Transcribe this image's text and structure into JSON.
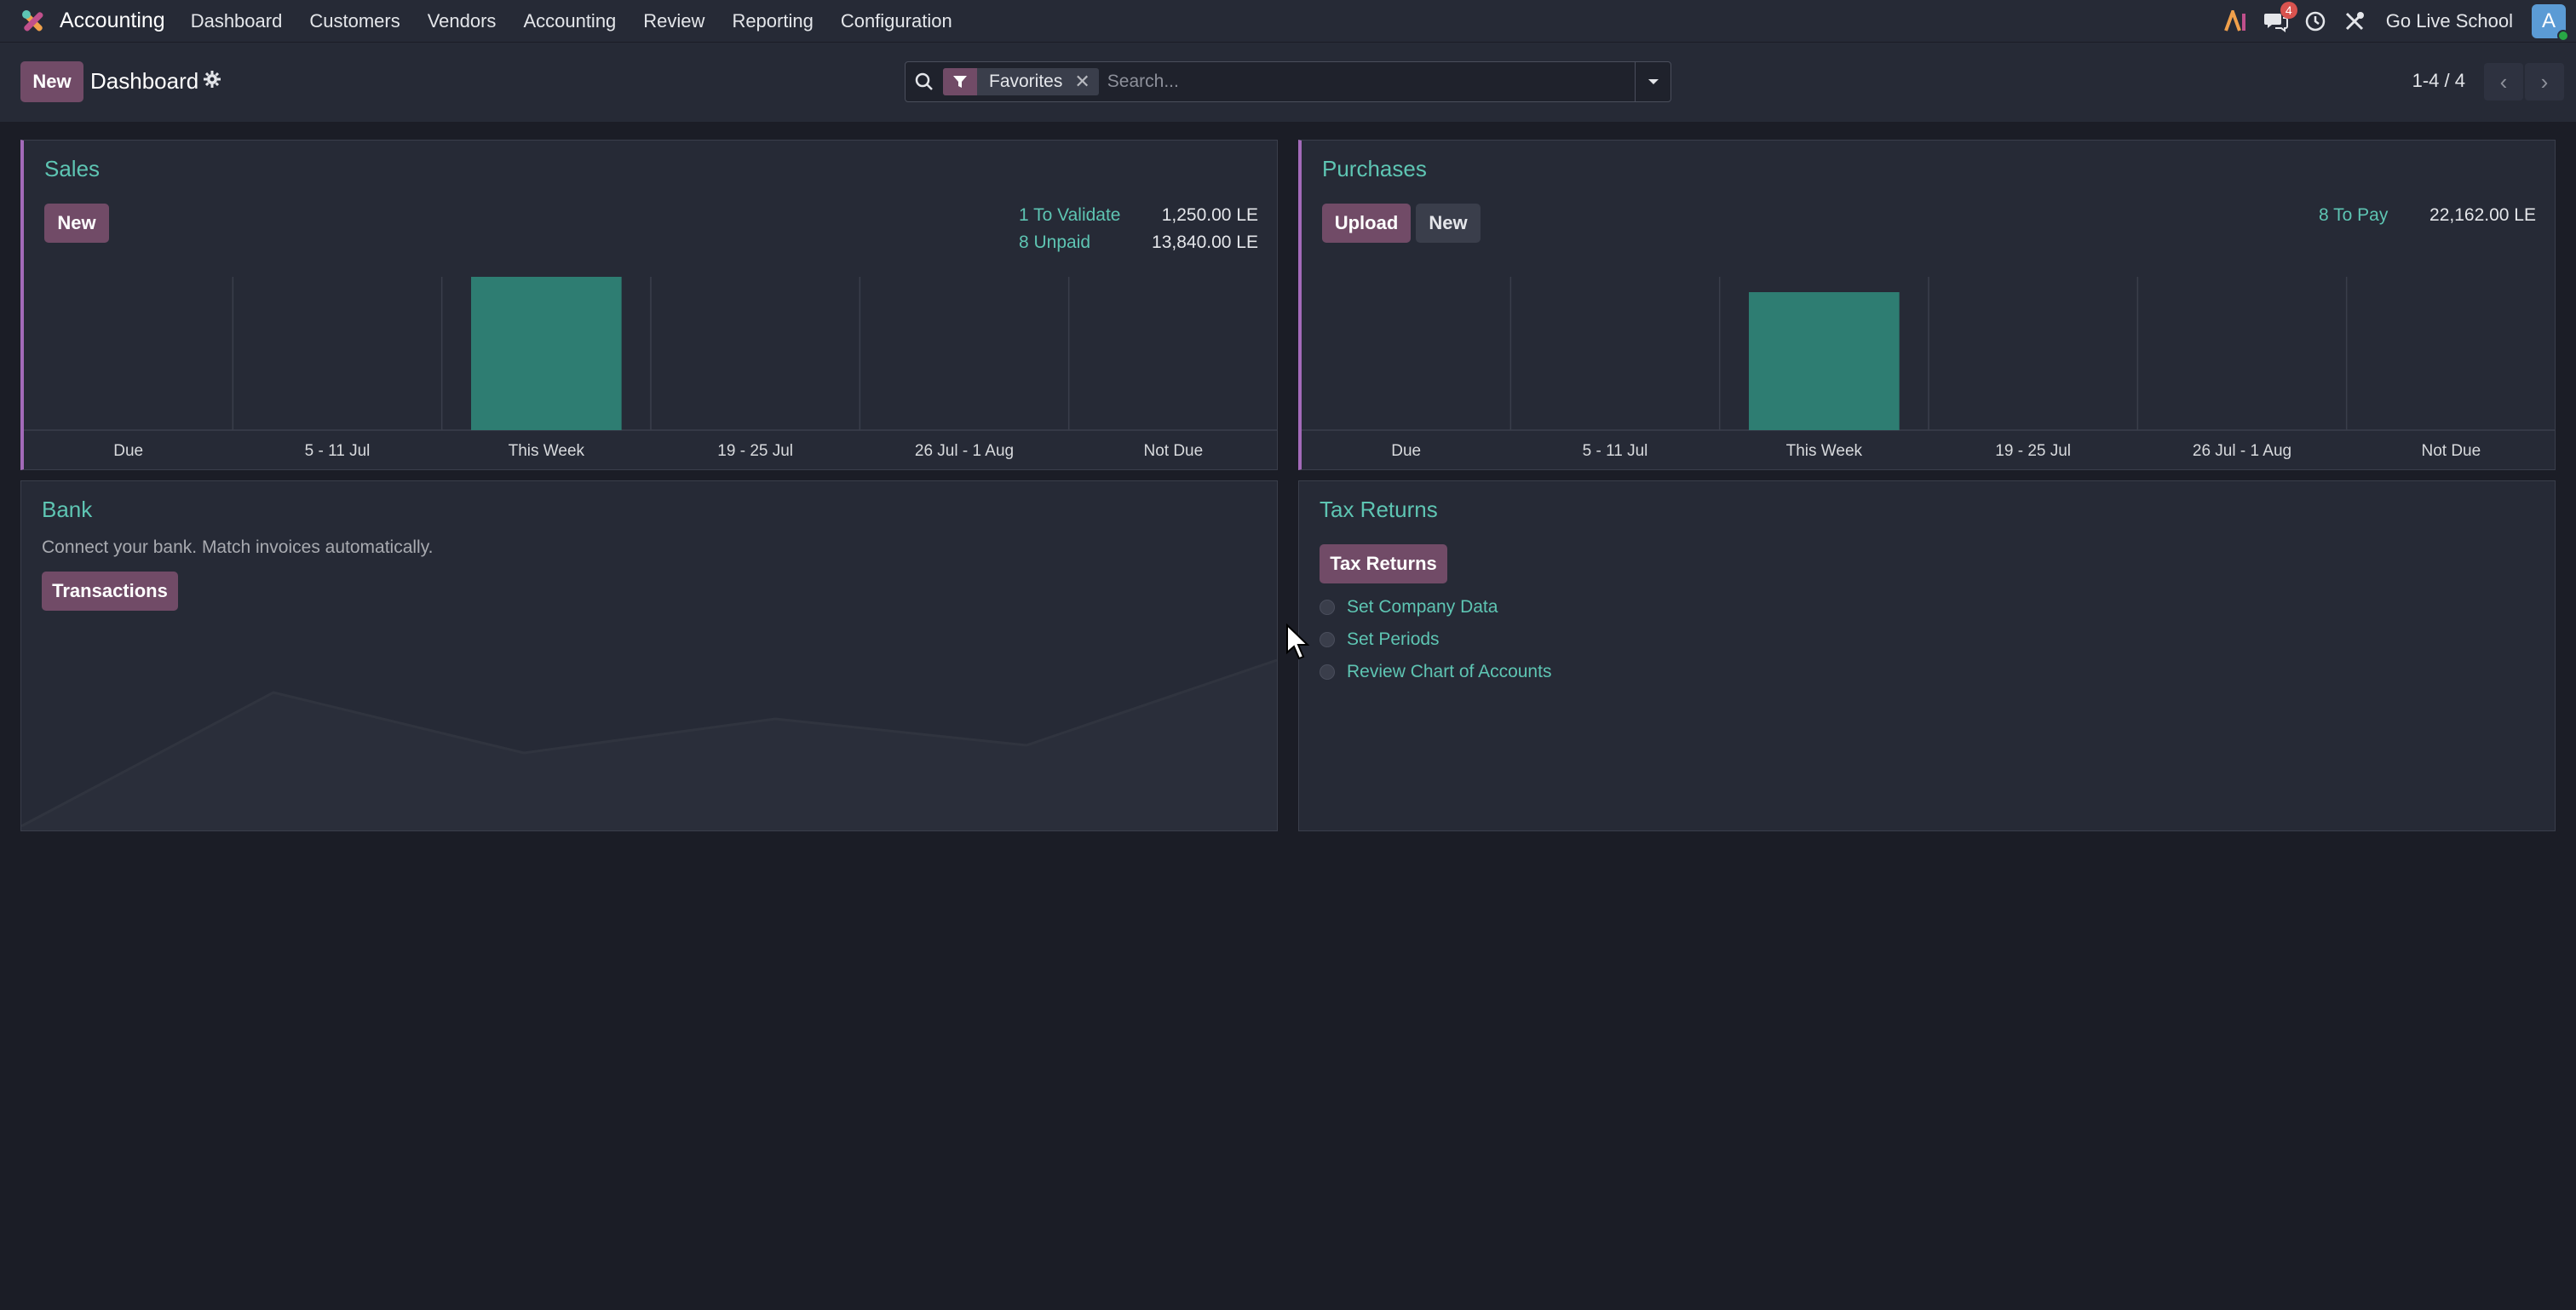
{
  "navbar": {
    "app_name": "Accounting",
    "menu": [
      "Dashboard",
      "Customers",
      "Vendors",
      "Accounting",
      "Review",
      "Reporting",
      "Configuration"
    ],
    "messages_badge": "4",
    "company": "Go Live School",
    "avatar_letter": "A"
  },
  "control_panel": {
    "new_label": "New",
    "title": "Dashboard",
    "search": {
      "facet": "Favorites",
      "placeholder": "Search..."
    },
    "pager": "1-4 / 4"
  },
  "sales": {
    "title": "Sales",
    "new_label": "New",
    "kpis": [
      {
        "label": "1 To Validate",
        "value": "1,250.00 LE"
      },
      {
        "label": "8 Unpaid",
        "value": "13,840.00 LE"
      }
    ]
  },
  "purchases": {
    "title": "Purchases",
    "upload_label": "Upload",
    "new_label": "New",
    "kpis": [
      {
        "label": "8 To Pay",
        "value": "22,162.00 LE"
      }
    ]
  },
  "bank": {
    "title": "Bank",
    "description": "Connect your bank. Match invoices automatically.",
    "transactions_label": "Transactions"
  },
  "tax_returns": {
    "title": "Tax Returns",
    "button_label": "Tax Returns",
    "steps": [
      "Set Company Data",
      "Set Periods",
      "Review Chart of Accounts"
    ]
  },
  "chart_data": [
    {
      "type": "bar",
      "categories": [
        "Due",
        "5 - 11 Jul",
        "This Week",
        "19 - 25 Jul",
        "26 Jul - 1 Aug",
        "Not Due"
      ],
      "values": [
        0,
        0,
        1250,
        0,
        0,
        0
      ],
      "color": "#2e7d72"
    },
    {
      "type": "bar",
      "categories": [
        "Due",
        "5 - 11 Jul",
        "This Week",
        "19 - 25 Jul",
        "26 Jul - 1 Aug",
        "Not Due"
      ],
      "values": [
        0,
        0,
        22162,
        0,
        0,
        0
      ],
      "color": "#2e7d72"
    }
  ],
  "colors": {
    "accent": "#714b67",
    "link": "#5ec5b3",
    "bar": "#2e7d72",
    "background": "#1b1d26",
    "panel": "#262a36"
  }
}
